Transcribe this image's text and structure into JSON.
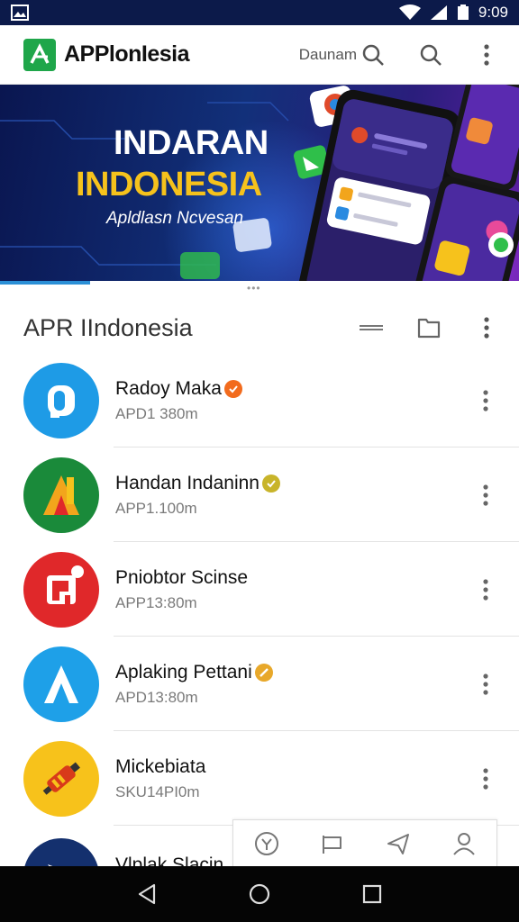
{
  "status_bar": {
    "time": "9:09",
    "icons": [
      "image-icon",
      "wifi-icon",
      "signal-icon",
      "battery-icon"
    ]
  },
  "app_bar": {
    "title": "APPlonIesia",
    "search_label": "Daunam",
    "icons": [
      "search-icon",
      "search-icon",
      "more-vert-icon"
    ]
  },
  "banner": {
    "title_line1": "INDARAN",
    "title_line2": "INDONESIA",
    "subtitle": "Apldlasn Ncvesan"
  },
  "section": {
    "title": "APR IIndonesia",
    "icons": [
      "minus-icon",
      "folder-icon",
      "more-vert-icon"
    ]
  },
  "apps": [
    {
      "name": "Radoy Maka",
      "meta": "APD1 380m",
      "icon_color": "#1e9be6",
      "badge_color": "#f26b1d"
    },
    {
      "name": "Handan Indaninn",
      "meta": "APP1.100m",
      "icon_color": "#1a8a3a",
      "badge_color": "#c8b42a"
    },
    {
      "name": "Pniobtor Scinse",
      "meta": "APP13:80m",
      "icon_color": "#e0282a",
      "badge_color": ""
    },
    {
      "name": "Aplaking Pettani",
      "meta": "APD13:80m",
      "icon_color": "#1ea0e8",
      "badge_color": "#e8a82a"
    },
    {
      "name": "Mickebiata",
      "meta": "SKU14PI0m",
      "icon_color": "#f7c21b",
      "badge_color": ""
    },
    {
      "name": "Vlplak Slacin",
      "meta": "",
      "icon_color": "#14306e",
      "badge_color": ""
    }
  ],
  "bottom_tabs": {
    "icons": [
      "badge-icon",
      "flag-icon",
      "send-icon",
      "person-icon"
    ]
  },
  "nav_bar": {
    "icons": [
      "back-icon",
      "home-icon",
      "recents-icon"
    ]
  },
  "colors": {
    "accent": "#2b8fd6",
    "status_bar": "#0c1a4a",
    "brand_green": "#1fa64a",
    "banner_yellow": "#f6c21c"
  }
}
